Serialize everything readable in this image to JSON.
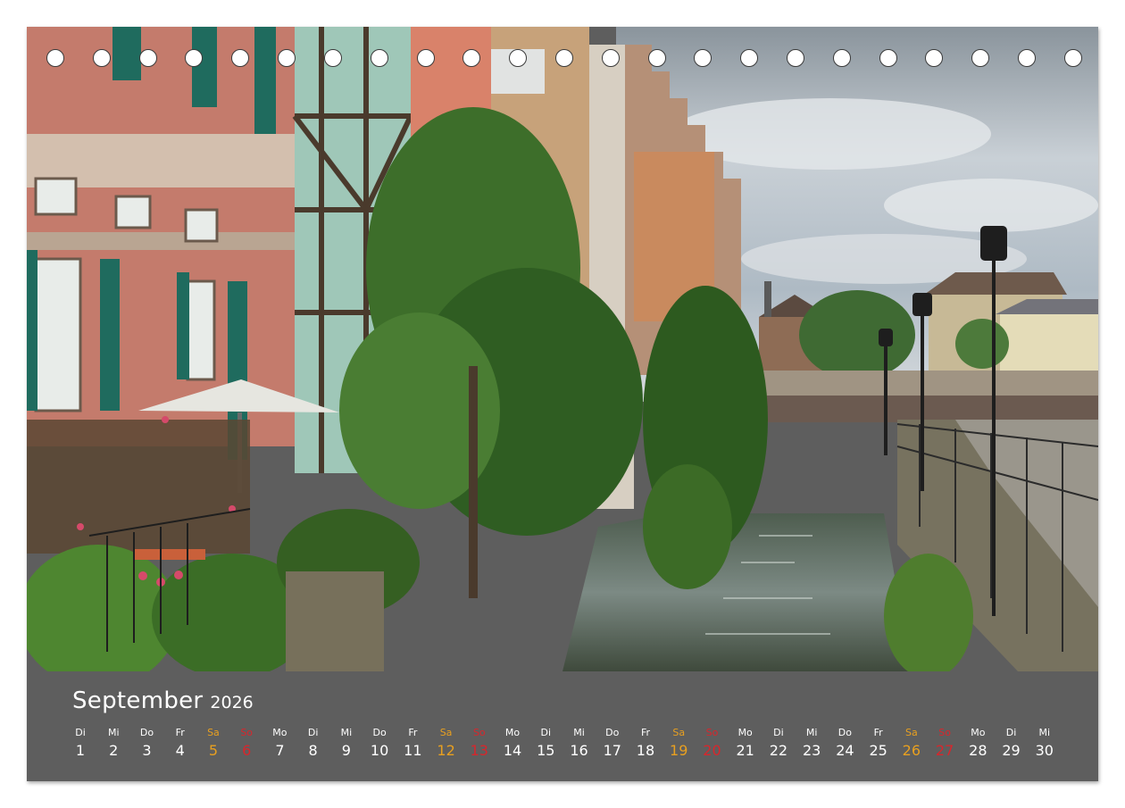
{
  "calendar": {
    "month": "September",
    "year": "2026",
    "days": [
      {
        "wd": "Di",
        "n": "1",
        "t": "w"
      },
      {
        "wd": "Mi",
        "n": "2",
        "t": "w"
      },
      {
        "wd": "Do",
        "n": "3",
        "t": "w"
      },
      {
        "wd": "Fr",
        "n": "4",
        "t": "w"
      },
      {
        "wd": "Sa",
        "n": "5",
        "t": "sat"
      },
      {
        "wd": "So",
        "n": "6",
        "t": "sun"
      },
      {
        "wd": "Mo",
        "n": "7",
        "t": "w"
      },
      {
        "wd": "Di",
        "n": "8",
        "t": "w"
      },
      {
        "wd": "Mi",
        "n": "9",
        "t": "w"
      },
      {
        "wd": "Do",
        "n": "10",
        "t": "w"
      },
      {
        "wd": "Fr",
        "n": "11",
        "t": "w"
      },
      {
        "wd": "Sa",
        "n": "12",
        "t": "sat"
      },
      {
        "wd": "So",
        "n": "13",
        "t": "sun"
      },
      {
        "wd": "Mo",
        "n": "14",
        "t": "w"
      },
      {
        "wd": "Di",
        "n": "15",
        "t": "w"
      },
      {
        "wd": "Mi",
        "n": "16",
        "t": "w"
      },
      {
        "wd": "Do",
        "n": "17",
        "t": "w"
      },
      {
        "wd": "Fr",
        "n": "18",
        "t": "w"
      },
      {
        "wd": "Sa",
        "n": "19",
        "t": "sat"
      },
      {
        "wd": "So",
        "n": "20",
        "t": "sun"
      },
      {
        "wd": "Mo",
        "n": "21",
        "t": "w"
      },
      {
        "wd": "Di",
        "n": "22",
        "t": "w"
      },
      {
        "wd": "Mi",
        "n": "23",
        "t": "w"
      },
      {
        "wd": "Do",
        "n": "24",
        "t": "w"
      },
      {
        "wd": "Fr",
        "n": "25",
        "t": "w"
      },
      {
        "wd": "Sa",
        "n": "26",
        "t": "sat"
      },
      {
        "wd": "So",
        "n": "27",
        "t": "sun"
      },
      {
        "wd": "Mo",
        "n": "28",
        "t": "w"
      },
      {
        "wd": "Di",
        "n": "29",
        "t": "w"
      },
      {
        "wd": "Mi",
        "n": "30",
        "t": "w"
      }
    ]
  },
  "colors": {
    "strip": "#5e5e5e",
    "weekday_text": "#ffffff",
    "saturday": "#e8a020",
    "sunday": "#d8262c"
  }
}
